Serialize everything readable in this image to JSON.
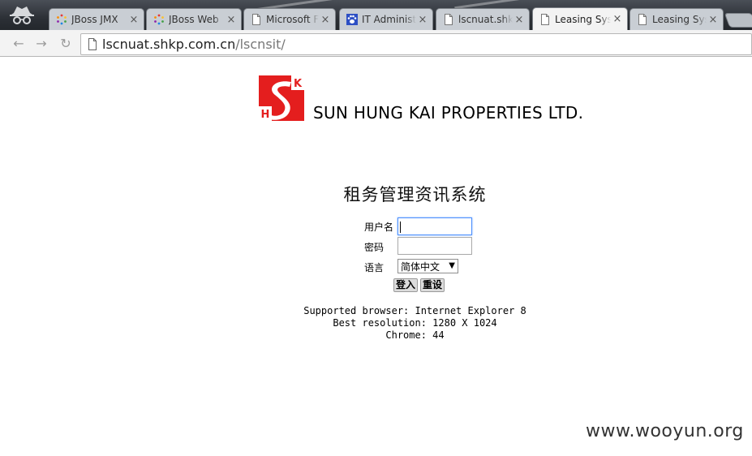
{
  "browser": {
    "tabs": [
      {
        "title": "JBoss JMX",
        "icon": "jboss-icon",
        "active": false
      },
      {
        "title": "JBoss Web",
        "icon": "jboss-icon",
        "active": false
      },
      {
        "title": "Microsoft F",
        "icon": "page-icon",
        "active": false
      },
      {
        "title": "IT Administ",
        "icon": "paw-icon",
        "active": false
      },
      {
        "title": "lscnuat.shk",
        "icon": "page-icon",
        "active": false
      },
      {
        "title": "Leasing Sys",
        "icon": "page-icon",
        "active": true
      },
      {
        "title": "Leasing Sys",
        "icon": "page-icon",
        "active": false
      }
    ],
    "tab_close": "×",
    "back_glyph": "←",
    "forward_glyph": "→",
    "reload_glyph": "↻",
    "url_host": "lscnuat.shkp.com.cn",
    "url_path": "/lscnsit/"
  },
  "page": {
    "company_name": "SUN HUNG KAI PROPERTIES LTD.",
    "logo_letters": [
      "S",
      "H",
      "K"
    ],
    "system_title": "租务管理资讯系统",
    "form": {
      "username_label": "用户名",
      "username_value": "",
      "password_label": "密码",
      "password_value": "",
      "language_label": "语言",
      "language_selected": "简体中文",
      "select_arrow": "▼",
      "login_button": "登入",
      "reset_button": "重设"
    },
    "notes": [
      "Supported browser: Internet Explorer 8",
      "Best resolution: 1280 X 1024",
      "Chrome: 44"
    ]
  },
  "watermark": "www.wooyun.org",
  "colors": {
    "logo_red": "#e41e1e",
    "focus_blue": "#4d90fe"
  }
}
